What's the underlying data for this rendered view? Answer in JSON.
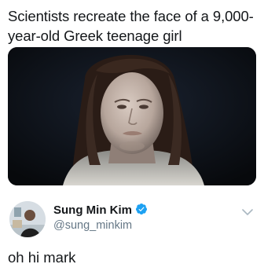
{
  "quoted_post": {
    "text": "Scientists recreate the face of a 9,000-year-old Greek teenage girl"
  },
  "tweet": {
    "display_name": "Sung Min Kim",
    "handle": "@sung_minkim",
    "verified": true,
    "verified_icon": "verified-badge-icon",
    "menu_icon": "chevron-down-icon",
    "text": "oh hi mark"
  },
  "colors": {
    "text_primary": "#14171a",
    "text_secondary": "#657786",
    "verified_blue": "#1da1f2"
  }
}
